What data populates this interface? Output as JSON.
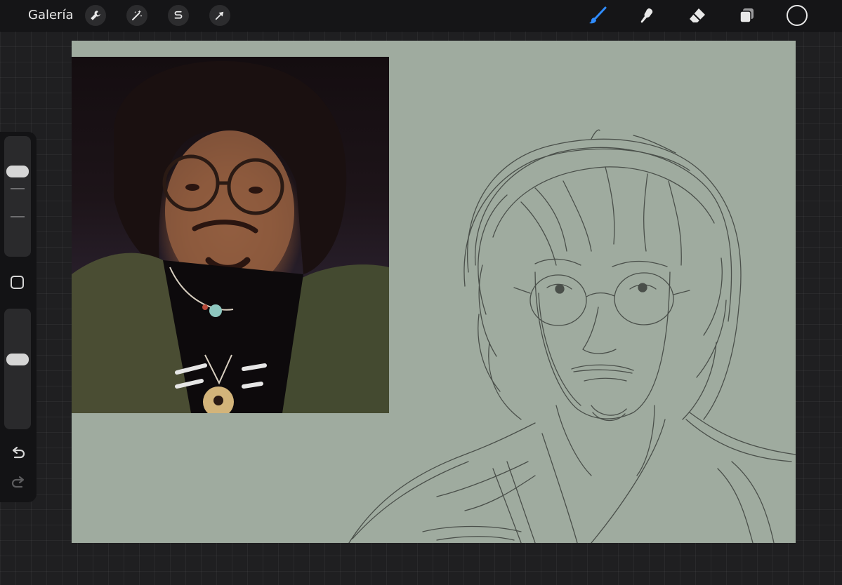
{
  "topbar": {
    "gallery_label": "Galería",
    "actions": [
      {
        "name": "wrench-icon"
      },
      {
        "name": "magic-wand-icon"
      },
      {
        "name": "selection-s-icon"
      },
      {
        "name": "arrow-cursor-icon"
      }
    ],
    "tools": [
      {
        "name": "brush-icon",
        "active": true
      },
      {
        "name": "smudge-icon",
        "active": false
      },
      {
        "name": "eraser-icon",
        "active": false
      },
      {
        "name": "layers-icon",
        "active": false
      }
    ],
    "active_color": "#151517"
  },
  "colors": {
    "accent": "#2f8cff",
    "canvas": "#9fab9f",
    "icon": "#e8e8e8"
  },
  "sidebar": {
    "brush_size_level": 0.74,
    "opacity_level": 0.59
  }
}
